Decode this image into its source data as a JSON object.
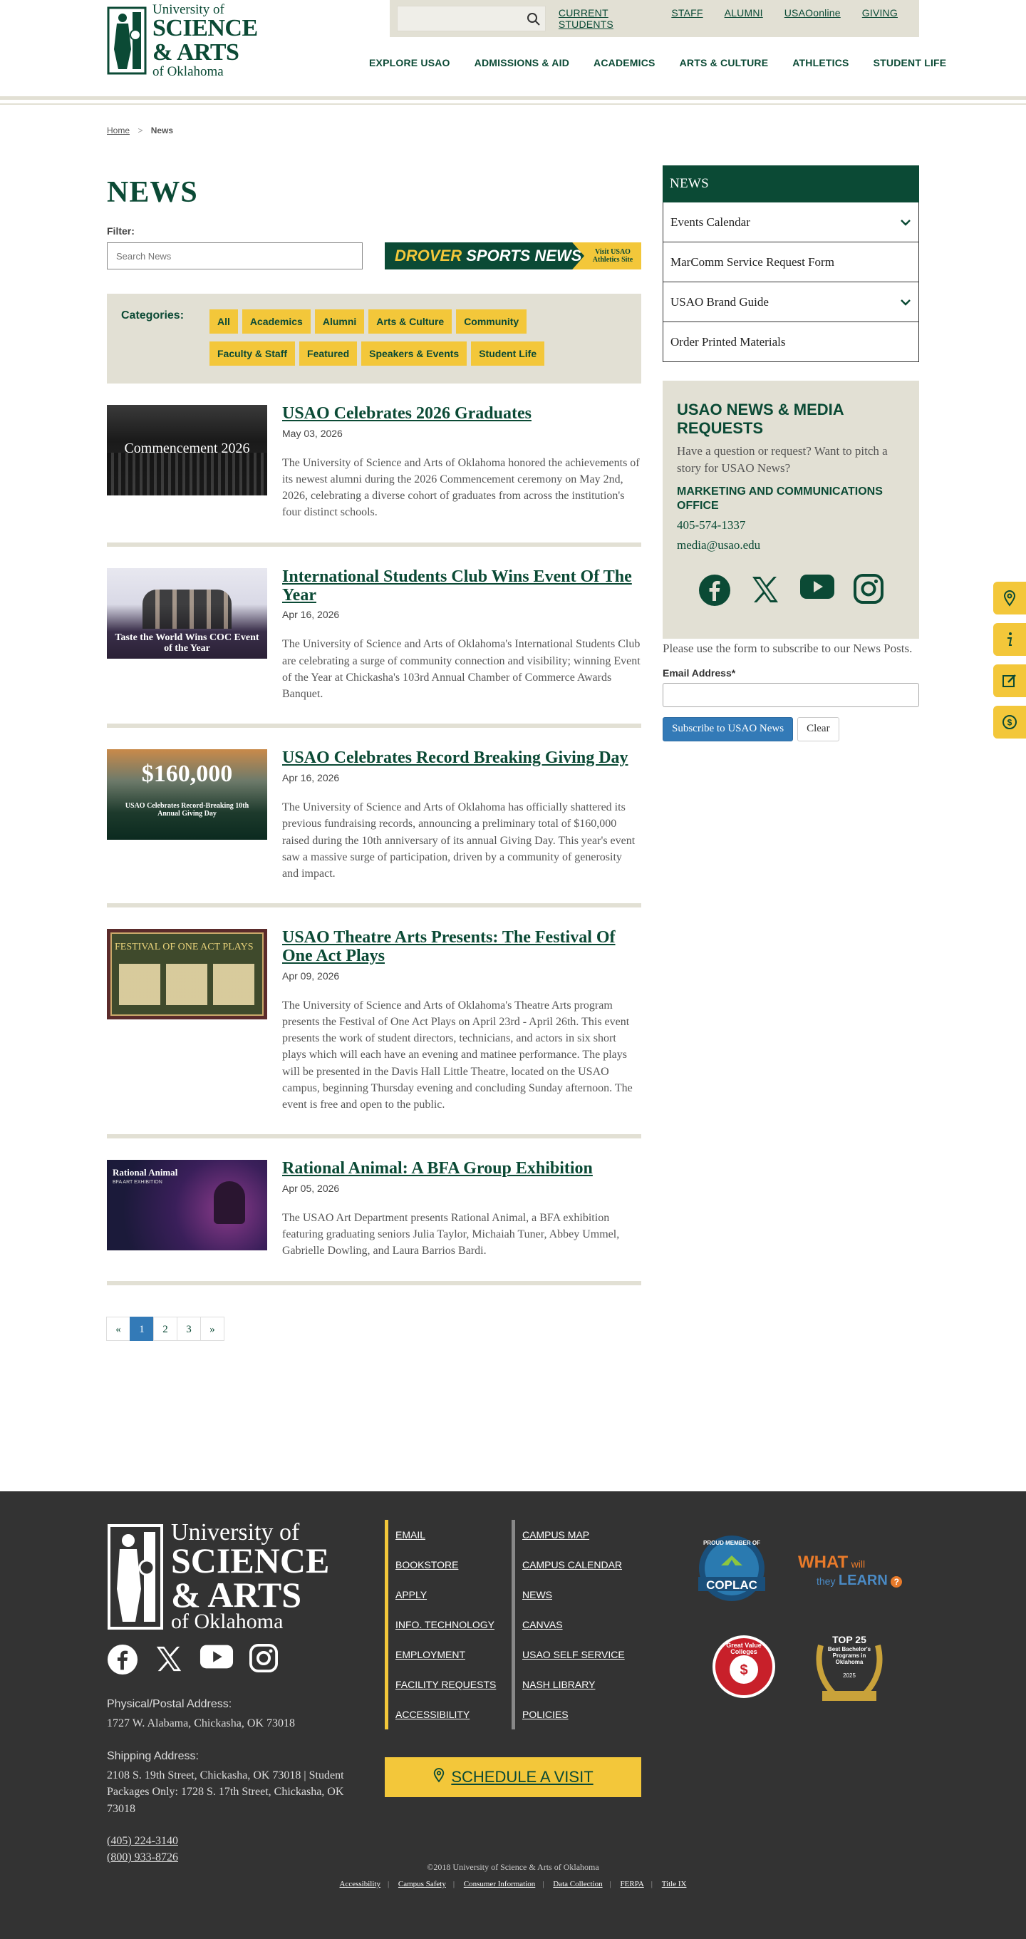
{
  "header": {
    "logo": {
      "line1": "University of",
      "line2": "SCIENCE",
      "line3": "& ARTS",
      "line4": "of Oklahoma"
    },
    "search_placeholder": "",
    "top_links": [
      "CURRENT STUDENTS",
      "STAFF",
      "ALUMNI",
      "USAOonline",
      "GIVING"
    ],
    "nav": [
      "EXPLORE USAO",
      "ADMISSIONS & AID",
      "ACADEMICS",
      "ARTS & CULTURE",
      "ATHLETICS",
      "STUDENT LIFE"
    ]
  },
  "breadcrumb": {
    "home": "Home",
    "sep": ">",
    "current": "News"
  },
  "page_title": "NEWS",
  "filter": {
    "label": "Filter:",
    "placeholder": "Search News"
  },
  "drover": {
    "main1": "DROVER ",
    "main2": "SPORTS NEWS",
    "side1": "Visit USAO",
    "side2": "Athletics Site"
  },
  "categories": {
    "label": "Categories:",
    "items": [
      "All",
      "Academics",
      "Alumni",
      "Arts & Culture",
      "Community",
      "Faculty & Staff",
      "Featured",
      "Speakers & Events",
      "Student Life"
    ]
  },
  "posts": [
    {
      "title": "USAO Celebrates 2026 Graduates",
      "date": "May 03, 2026",
      "excerpt": "The University of Science and Arts of Oklahoma honored the achievements of its newest alumni during the 2026 Commencement ceremony on May 2nd, 2026, celebrating a diverse cohort of graduates from across the institution's four distinct schools.",
      "thumb_text": "Commencement 2026"
    },
    {
      "title": "International Students Club Wins Event Of The Year",
      "date": "Apr 16, 2026",
      "excerpt": "The University of Science and Arts of Oklahoma's International Students Club are celebrating a surge of community connection and visibility; winning Event of the Year at Chickasha's 103rd Annual Chamber of Commerce Awards Banquet.",
      "thumb_text": "Taste the World Wins COC Event of the Year"
    },
    {
      "title": "USAO Celebrates Record Breaking Giving Day",
      "date": "Apr 16, 2026",
      "excerpt": "The University of Science and Arts of Oklahoma has officially shattered its previous fundraising records, announcing a preliminary total of $160,000 raised during the 10th anniversary of its annual Giving Day. This year's event saw a massive surge of participation, driven by a community of generosity and impact.",
      "thumb_text": "$160,000",
      "thumb_sub": "USAO Celebrates Record-Breaking 10th Annual Giving Day"
    },
    {
      "title": "USAO Theatre Arts Presents: The Festival Of One Act Plays",
      "date": "Apr 09, 2026",
      "excerpt": "The University of Science and Arts of Oklahoma's Theatre Arts program presents the Festival of One Act Plays on April 23rd - April 26th. This event presents the work of student directors, technicians, and actors in six short plays which will each have an evening and matinee performance. The plays will be presented in the Davis Hall Little Theatre, located on the USAO campus, beginning Thursday evening and concluding Sunday afternoon. The event is free and open to the public.",
      "thumb_text": "FESTIVAL OF ONE ACT PLAYS"
    },
    {
      "title": "Rational Animal: A BFA Group Exhibition",
      "date": "Apr 05, 2026",
      "excerpt": "The USAO Art Department presents Rational Animal, a BFA exhibition featuring graduating seniors Julia Taylor, Michaiah Tuner, Abbey Ummel, Gabrielle Dowling, and Laura Barrios Bardi.",
      "thumb_text": "Rational Animal",
      "thumb_sub": "BFA ART EXHIBITION"
    }
  ],
  "pagination": [
    "«",
    "1",
    "2",
    "3",
    "»"
  ],
  "sidebar": {
    "header": "NEWS",
    "items": [
      {
        "label": "Events Calendar",
        "has_chevron": true
      },
      {
        "label": "MarComm Service Request Form",
        "has_chevron": false
      },
      {
        "label": "USAO Brand Guide",
        "has_chevron": true
      },
      {
        "label": "Order Printed Materials",
        "has_chevron": false
      }
    ],
    "media": {
      "title": "USAO NEWS & MEDIA REQUESTS",
      "question": "Have a question or request? Want to pitch a story for USAO News?",
      "office": "MARKETING AND COMMUNICATIONS OFFICE",
      "phone": "405-574-1337",
      "email": "media@usao.edu"
    },
    "subscribe_text": "Please use the form to subscribe to our News Posts.",
    "email_label": "Email Address*",
    "subscribe_btn": "Subscribe to USAO News",
    "clear_btn": "Clear"
  },
  "footer": {
    "logo": {
      "line1": "University of",
      "line2": "SCIENCE",
      "line3": "& ARTS",
      "line4": "of Oklahoma"
    },
    "physical_label": "Physical/Postal Address:",
    "physical": "1727 W. Alabama, Chickasha, OK 73018",
    "shipping_label": "Shipping Address:",
    "shipping": "2108 S. 19th Street, Chickasha, OK 73018 | Student Packages Only: 1728 S. 17th Street, Chickasha, OK 73018",
    "phone1": "(405) 224-3140",
    "phone2": "(800) 933-8726",
    "col1": [
      "EMAIL",
      "BOOKSTORE",
      "APPLY",
      "INFO. TECHNOLOGY",
      "EMPLOYMENT",
      "FACILITY REQUESTS",
      "ACCESSIBILITY"
    ],
    "col2": [
      "CAMPUS MAP",
      "CAMPUS CALENDAR",
      "NEWS",
      "CANVAS",
      "USAO SELF SERVICE",
      "NASH LIBRARY",
      "POLICIES"
    ],
    "schedule": "SCHEDULE A VISIT",
    "badge_coplac": "COPLAC",
    "badge_coplac_top": "PROUD MEMBER OF",
    "badge_what1": "WHAT",
    "badge_what2": "will",
    "badge_what3": "they",
    "badge_what4": "LEARN",
    "badge_gvc": "Great Value Colleges",
    "badge_top25": "TOP 25",
    "badge_top25_sub": "Best Bachelor's Programs in Oklahoma",
    "badge_top25_year": "2025",
    "copyright": "©2018 University of Science & Arts of Oklahoma",
    "bottom_links": [
      "Accessibility",
      "Campus Safety",
      "Consumer Information",
      "Data Collection",
      "FERPA",
      "Title IX"
    ]
  },
  "colors": {
    "green": "#0b4a35",
    "gold": "#f3c73a",
    "tan": "#e2e0d4",
    "blue": "#337ab7",
    "footer": "#333333"
  }
}
